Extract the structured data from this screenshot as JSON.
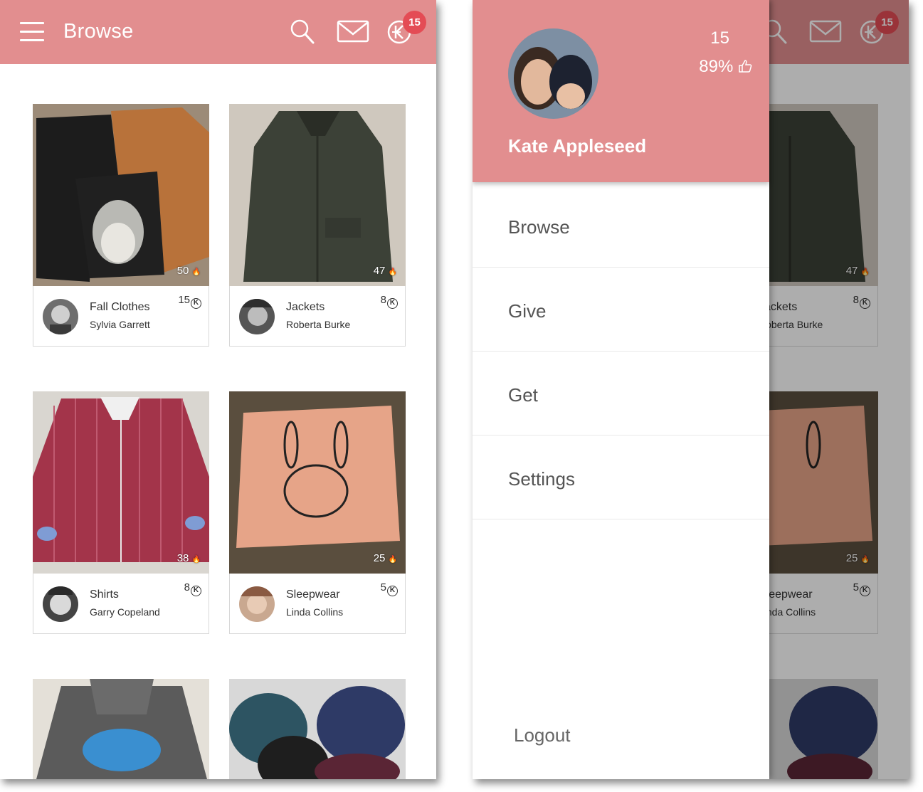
{
  "colors": {
    "accent": "#e28e8f",
    "badge": "#e44c55"
  },
  "appbar": {
    "title": "Browse",
    "menu_icon": "hamburger-menu-icon",
    "search_icon": "search-icon",
    "mail_icon": "mail-icon",
    "coin_icon": "coin-icon",
    "coin_badge": "15"
  },
  "listings": [
    {
      "title": "Fall Clothes",
      "owner": "Sylvia Garrett",
      "price": "15",
      "likes": "50"
    },
    {
      "title": "Jackets",
      "owner": "Roberta Burke",
      "price": "8",
      "likes": "47"
    },
    {
      "title": "Shirts",
      "owner": "Garry Copeland",
      "price": "8",
      "likes": "38"
    },
    {
      "title": "Sleepwear",
      "owner": "Linda Collins",
      "price": "5",
      "likes": "25"
    }
  ],
  "coin_symbol": "K",
  "flame_symbol": "🔥",
  "drawer": {
    "profile": {
      "name": "Kate Appleseed",
      "coins": "15",
      "rating": "89%"
    },
    "menu": [
      "Browse",
      "Give",
      "Get",
      "Settings"
    ],
    "logout": "Logout"
  }
}
